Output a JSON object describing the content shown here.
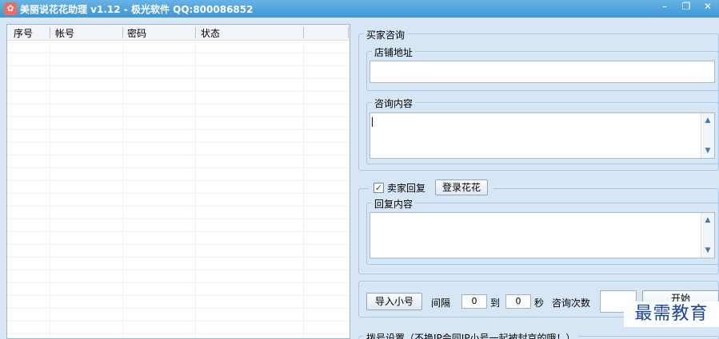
{
  "window": {
    "title": "美丽说花花助理 v1.12 - 极光软件 QQ:800086852",
    "controls": {
      "minimize": "–",
      "restore": "❐",
      "close": "✕"
    }
  },
  "account_table": {
    "columns": [
      "序号",
      "帐号",
      "密码",
      "状态"
    ],
    "rows": []
  },
  "buyer_inquiry": {
    "title": "买家咨询",
    "shop_address": {
      "label": "店铺地址",
      "value": ""
    },
    "inquiry_content": {
      "label": "咨询内容",
      "value": ""
    }
  },
  "seller_reply": {
    "checkbox_label": "卖家回复",
    "checked": true,
    "check_mark": "✓",
    "login_button": "登录花花",
    "reply_content": {
      "label": "回复内容",
      "value": ""
    }
  },
  "actions": {
    "import_button": "导入小号",
    "interval_label": "间隔",
    "interval_from": "0",
    "to_label": "到",
    "interval_to": "0",
    "seconds_label": "秒",
    "count_label": "咨询次数",
    "count_value": "",
    "start_button": "开始"
  },
  "dial_settings": {
    "title": "拨号设置（不换IP会同IP小号一起被封京的哦！）"
  },
  "scroll_glyphs": {
    "up": "▲",
    "down": "▼"
  },
  "watermark": {
    "text": "最需教育"
  },
  "colors": {
    "titlebar": "#4aa0dc",
    "background": "#d6e6f4",
    "watermark": "#17479b"
  }
}
